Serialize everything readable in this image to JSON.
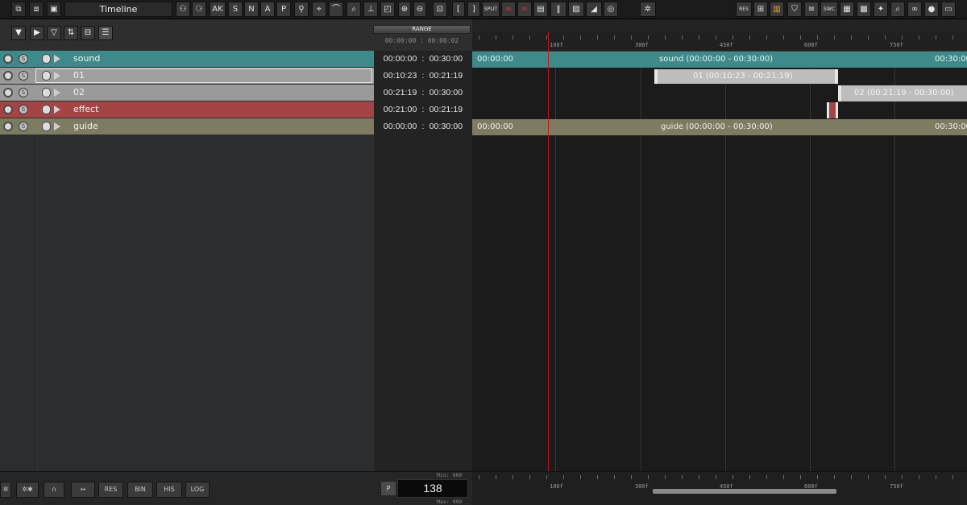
{
  "window": {
    "title": "Timeline"
  },
  "toolbar": {
    "left_icons": [
      "window-a-icon",
      "window-b-icon",
      "window-c-icon"
    ],
    "main_labels": [
      "AK",
      "S",
      "N",
      "A",
      "P",
      "[",
      "]",
      "SPLIT"
    ],
    "right_labels": [
      "RES",
      "SWC"
    ]
  },
  "track_header": {
    "range_button": "RANGE",
    "range_value": "00:00:00 : 00:00:02"
  },
  "tracks": [
    {
      "name": "sound",
      "in": "00:00:00",
      "out": "00:30:00",
      "color": "#3e8a8a"
    },
    {
      "name": "01",
      "in": "00:10:23",
      "out": "00:21:19",
      "color": "#9a9a9a"
    },
    {
      "name": "02",
      "in": "00:21:19",
      "out": "00:30:00",
      "color": "#9a9a9a"
    },
    {
      "name": "effect",
      "in": "00:21:00",
      "out": "00:21:19",
      "color": "#a54444"
    },
    {
      "name": "guide",
      "in": "00:00:00",
      "out": "00:30:00",
      "color": "#7e7b63"
    }
  ],
  "range_separator": ":",
  "clips": {
    "sound": {
      "left": "00:00:00",
      "center": "sound  (00:00:00  -  00:30:00)",
      "right": "00:30:00"
    },
    "c01": {
      "center": "01  (00:10:23  -  00:21:19)"
    },
    "c02": {
      "center": "02  (00:21:19  -  00:30:00)"
    },
    "guide": {
      "left": "00:00:00",
      "center": "guide  (00:00:00  -  00:30:00)",
      "right": "00:30:00"
    }
  },
  "ruler": {
    "labels": [
      "100f",
      "300f",
      "450f",
      "600f",
      "750f"
    ]
  },
  "bottom": {
    "buttons": [
      "RES",
      "BIN",
      "HIS",
      "LOG"
    ],
    "p_label": "P",
    "frame": "138",
    "min_label": "Min: 000",
    "max_label": "Max: 999"
  }
}
